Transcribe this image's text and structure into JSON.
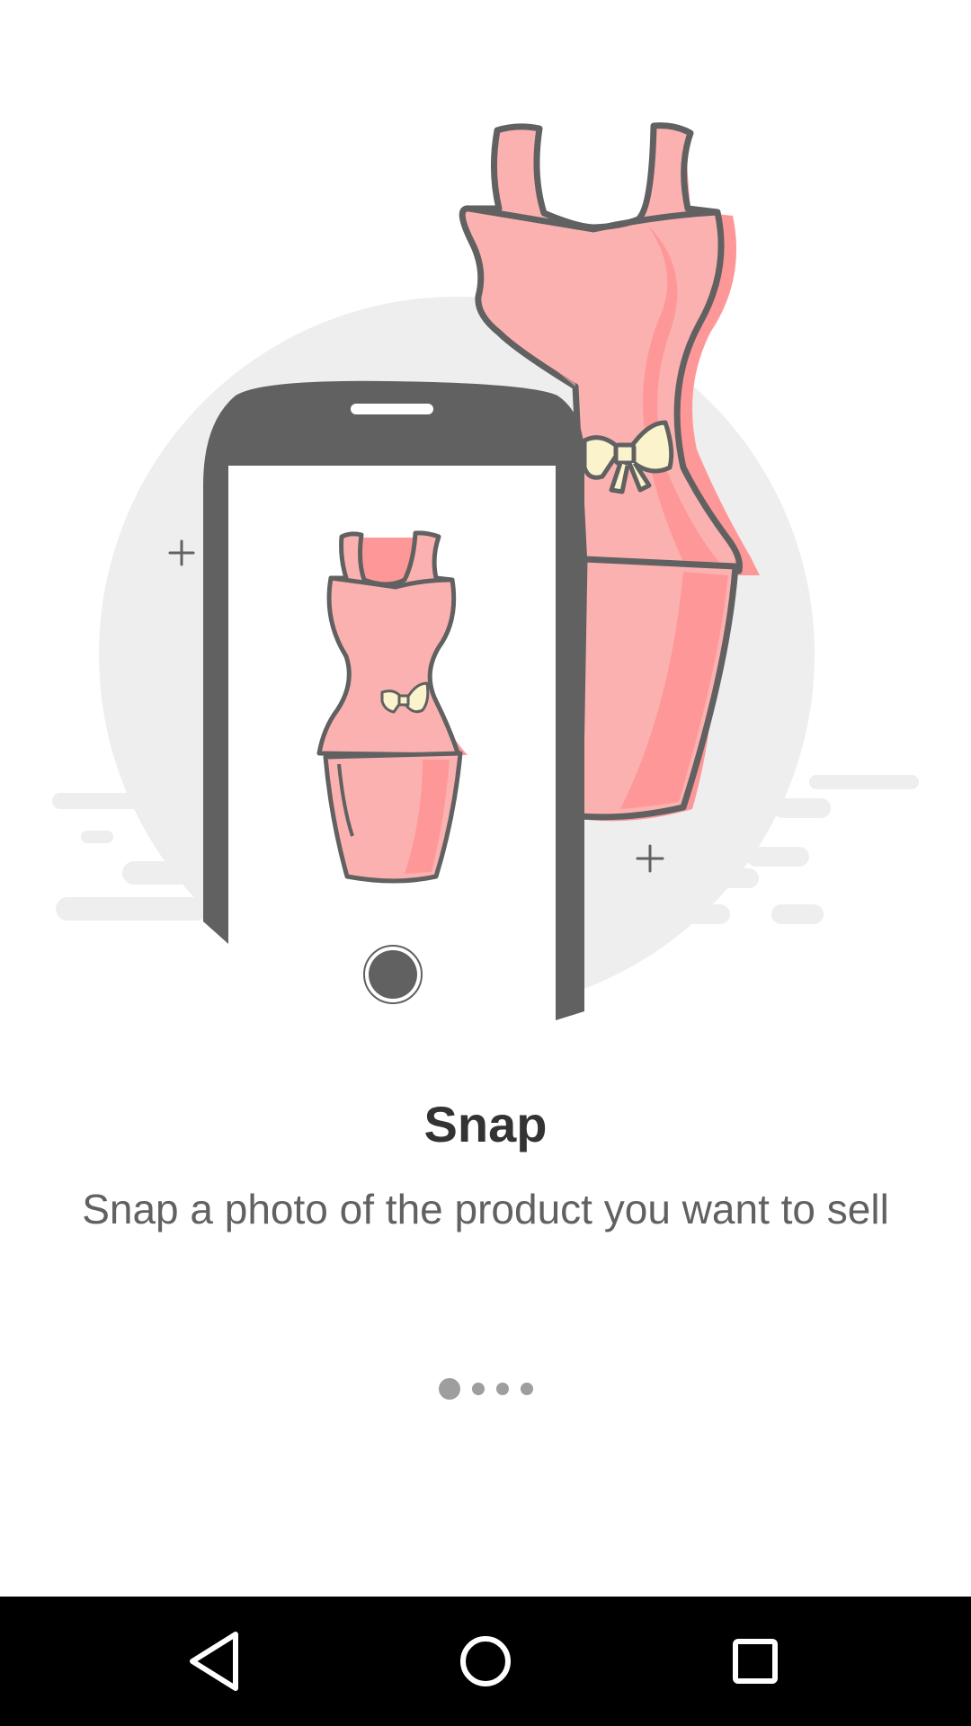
{
  "onboarding": {
    "title": "Snap",
    "description": "Snap a photo of the product you want to sell",
    "page_indicator": {
      "total": 4,
      "current": 1
    }
  },
  "illustration": {
    "icon": "phone-snapping-dress-illustration"
  },
  "navigation_bar": {
    "buttons": [
      {
        "name": "back",
        "icon": "back-triangle-icon"
      },
      {
        "name": "home",
        "icon": "home-circle-icon"
      },
      {
        "name": "recents",
        "icon": "recents-square-icon"
      }
    ]
  },
  "colors": {
    "dress": "#fcb1b1",
    "dress_shadow": "#fe9898",
    "outline": "#616161",
    "bow": "#fbf3cc",
    "background_circle": "#eeeeee",
    "indicator": "#9e9e9e"
  }
}
